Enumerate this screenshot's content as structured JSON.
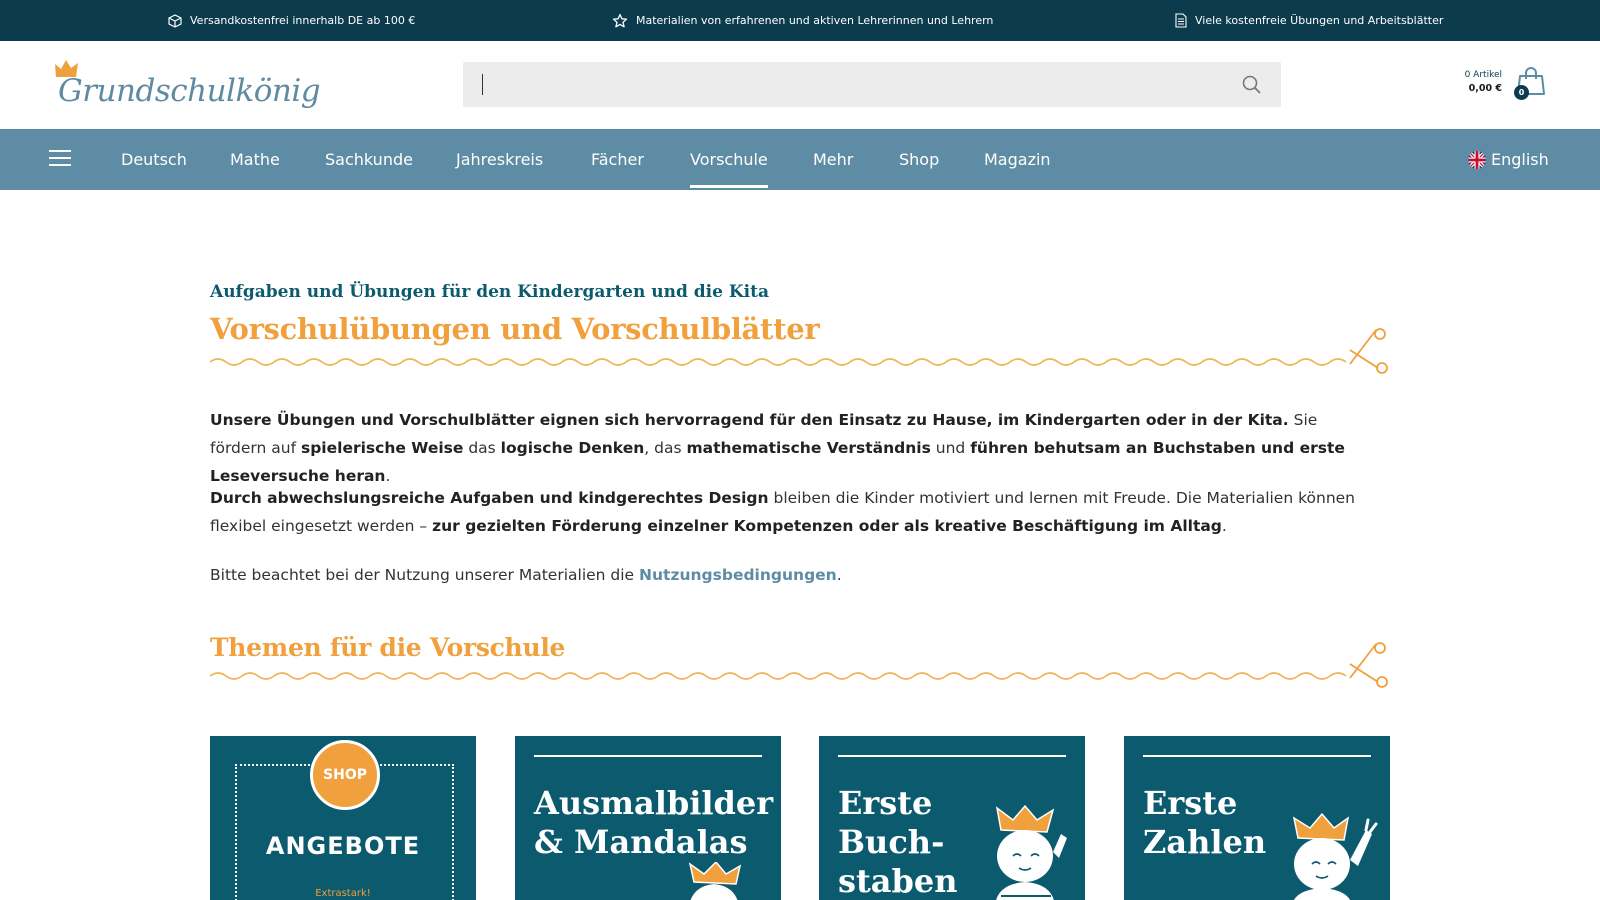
{
  "topbar": {
    "items": [
      {
        "icon": "box-icon",
        "text": "Versandkostenfrei innerhalb DE ab 100 €"
      },
      {
        "icon": "star-icon",
        "text": "Materialien von erfahrenen und aktiven Lehrerinnen und Lehrern"
      },
      {
        "icon": "document-icon",
        "text": "Viele kostenfreie Übungen und Arbeitsblätter"
      }
    ]
  },
  "header": {
    "logo_text": "Grundschulkönig",
    "search": {
      "value": "",
      "placeholder": ""
    },
    "cart": {
      "count_label": "0 Artikel",
      "sum": "0,00 €",
      "badge": "0"
    }
  },
  "nav": {
    "items": [
      "Deutsch",
      "Mathe",
      "Sachkunde",
      "Jahreskreis",
      "Fächer",
      "Vorschule",
      "Mehr",
      "Shop",
      "Magazin"
    ],
    "active": "Vorschule",
    "language": "English"
  },
  "main": {
    "subtitle": "Aufgaben und Übungen für den Kindergarten und die Kita",
    "title": "Vorschulübungen und Vorschulblätter",
    "p1_b1": "Unsere Übungen und Vorschulblätter eignen sich hervorragend für den Einsatz zu Hause, im Kindergarten oder in der Kita.",
    "p1_t1": " Sie fördern auf ",
    "p1_b2": "spielerische Weise",
    "p1_t2": " das ",
    "p1_b3": "logische Denken",
    "p1_t3": ", das ",
    "p1_b4": "mathematische Verständnis",
    "p1_t4": " und ",
    "p1_b5": "führen behutsam an Buchstaben und erste Leseversuche heran",
    "p1_t5": ".",
    "p2_b1": "Durch abwechslungsreiche Aufgaben und kindgerechtes Design",
    "p2_t1": " bleiben die Kinder motiviert und lernen mit Freude. Die Materialien können flexibel eingesetzt werden – ",
    "p2_b2": "zur gezielten Förderung einzelner Kompetenzen oder als kreative Beschäftigung im Alltag",
    "p2_t2": ".",
    "p3_t1": "Bitte beachtet bei der Nutzung unserer Materialien die ",
    "p3_link": "Nutzungsbedingungen",
    "p3_t2": ".",
    "section_title": "Themen für die Vorschule"
  },
  "cards": [
    {
      "badge": "SHOP",
      "title": "ANGEBOTE",
      "sub": "Extrastark!"
    },
    {
      "title_l1": "Ausmalbilder",
      "title_l2": "& Mandalas"
    },
    {
      "title_l1": "Erste",
      "title_l2": "Buch-",
      "title_l3": "staben"
    },
    {
      "title_l1": "Erste",
      "title_l2": "Zahlen"
    }
  ],
  "colors": {
    "topbar": "#0b3b4c",
    "nav": "#5e8ca5",
    "accent_orange": "#f0a03c",
    "card": "#0b5a6e"
  }
}
